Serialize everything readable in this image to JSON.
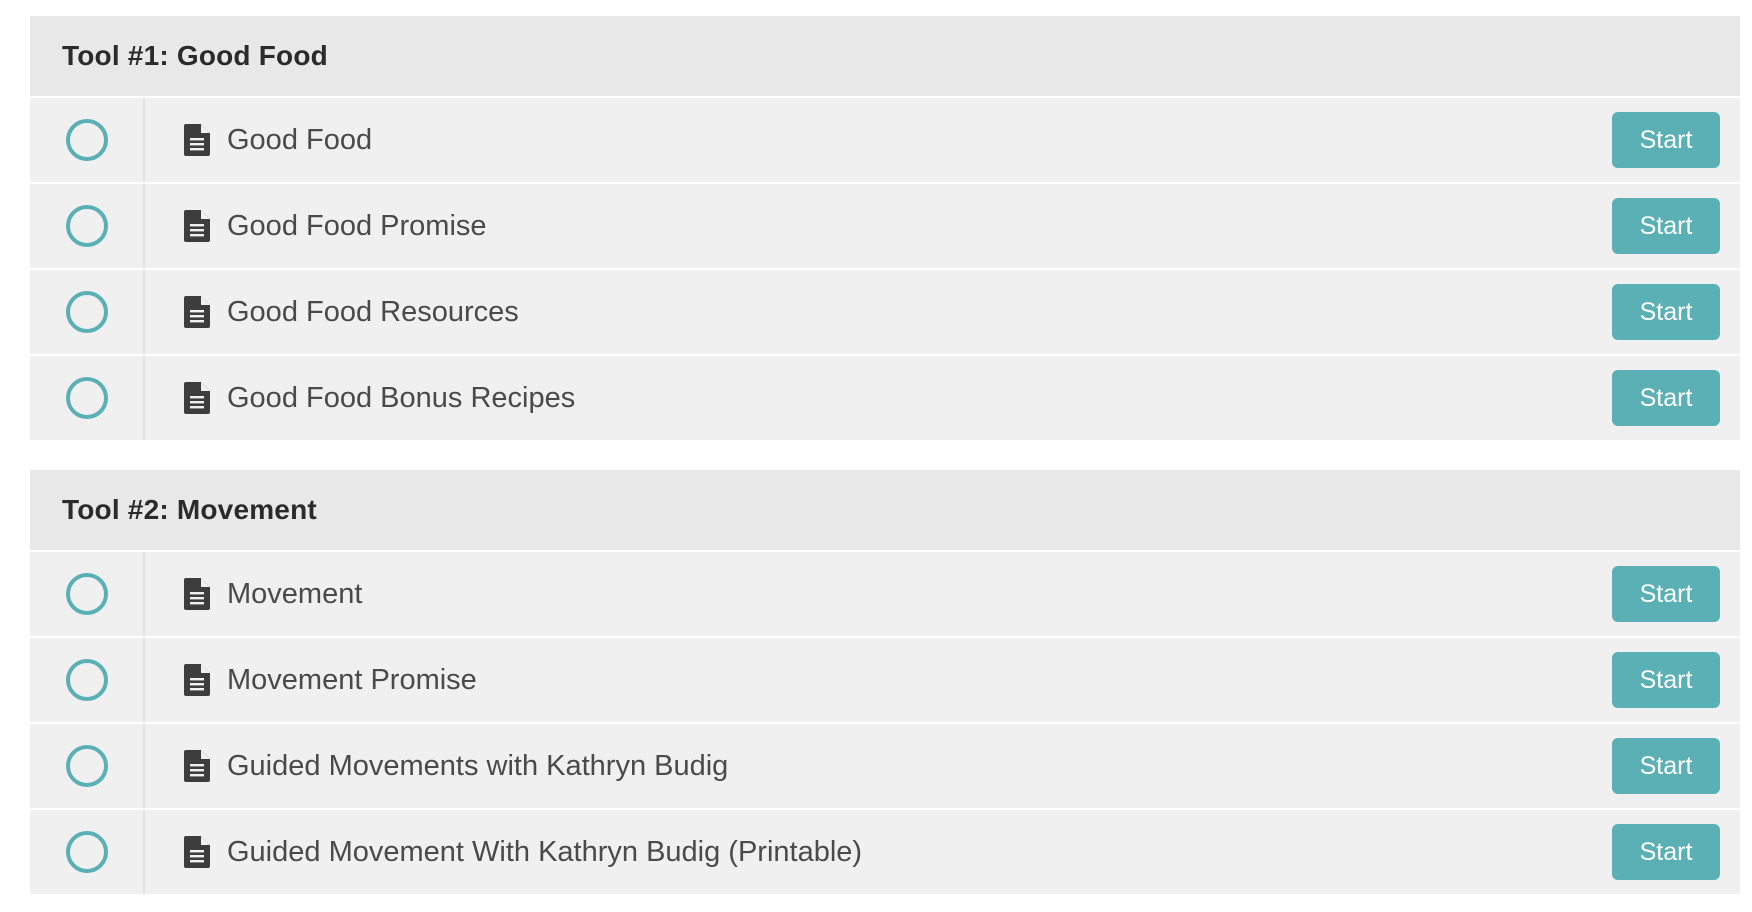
{
  "sections": [
    {
      "title": "Tool #1: Good Food",
      "lessons": [
        {
          "title": "Good Food",
          "button": "Start"
        },
        {
          "title": "Good Food Promise",
          "button": "Start"
        },
        {
          "title": "Good Food Resources",
          "button": "Start"
        },
        {
          "title": "Good Food Bonus Recipes",
          "button": "Start"
        }
      ]
    },
    {
      "title": "Tool #2: Movement",
      "lessons": [
        {
          "title": "Movement",
          "button": "Start"
        },
        {
          "title": "Movement Promise",
          "button": "Start"
        },
        {
          "title": "Guided Movements with Kathryn Budig",
          "button": "Start"
        },
        {
          "title": "Guided Movement With Kathryn Budig (Printable)",
          "button": "Start"
        }
      ]
    }
  ],
  "colors": {
    "accent": "#5bb0b5",
    "row_background": "#f0f0f0",
    "header_background": "#e8e8e8",
    "text": "#4a4a4a"
  },
  "icons": {
    "status": "circle-outline-icon",
    "lesson": "document-icon"
  }
}
